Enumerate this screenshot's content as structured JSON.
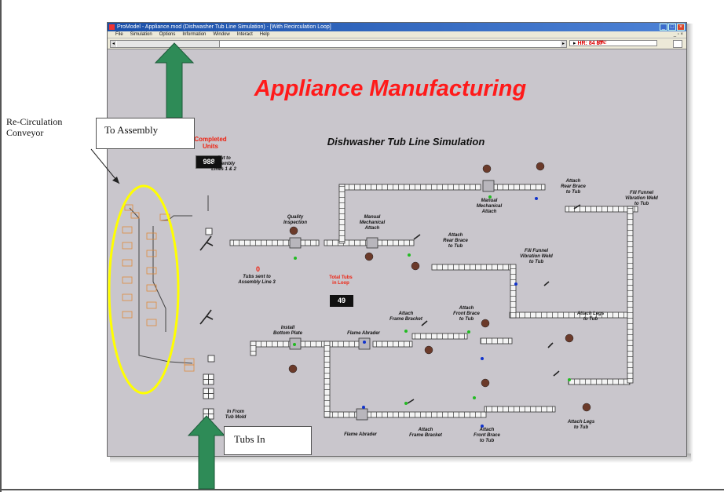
{
  "window": {
    "title": "ProModel - Appliance.mod (Dishwasher Tub Line Simulation) - [With Recirculation Loop]",
    "menu": [
      "File",
      "Simulation",
      "Options",
      "Information",
      "Window",
      "Interact",
      "Help"
    ],
    "clock": {
      "hr_label": "HR:",
      "hr": "84",
      "min_label": "MIN:",
      "min": "17"
    }
  },
  "display": {
    "title": "Appliance Manufacturing",
    "subtitle": "Dishwasher Tub Line Simulation",
    "completed_label_1": "Completed",
    "completed_label_2": "Units",
    "completed_value": "988",
    "loop_label_1": "Total Tubs",
    "loop_label_2": "in Loop",
    "loop_value": "49",
    "sent_value": "0"
  },
  "labels": {
    "out_to_assembly": [
      "Out to",
      "Assembly",
      "Lines 1 & 2"
    ],
    "tubs_sent": [
      "Tubs sent to",
      "Assembly Line 3"
    ],
    "in_from_tub_mold": [
      "In From",
      "Tub Mold"
    ],
    "quality_inspection": [
      "Quality",
      "Inspection"
    ],
    "manual_mech_top": [
      "Manual",
      "Mechanical",
      "Attach"
    ],
    "manual_mech_right": [
      "Manual",
      "Mechanical",
      "Attach"
    ],
    "attach_rear_brace_top": [
      "Attach",
      "Rear Brace",
      "to Tub"
    ],
    "fill_funnel_top": [
      "Fill Funnel",
      "Vibration Weld",
      "to Tub"
    ],
    "attach_rear_brace_mid": [
      "Attach",
      "Rear Brace",
      "to Tub"
    ],
    "fill_funnel_mid": [
      "Fill Funnel",
      "Vibration Weld",
      "to Tub"
    ],
    "attach_legs_mid": [
      "Attach Legs",
      "to Tub"
    ],
    "install_bottom_plate": [
      "Install",
      "Bottom Plate"
    ],
    "flame_abrader_mid": [
      "Flame Abrader"
    ],
    "attach_frame_bracket_mid": [
      "Attach",
      "Frame Bracket"
    ],
    "attach_front_brace_mid": [
      "Attach",
      "Front Brace",
      "to Tub"
    ],
    "flame_abrader_bottom": [
      "Flame Abrader"
    ],
    "attach_frame_bracket_bottom": [
      "Attach",
      "Frame Bracket"
    ],
    "attach_front_brace_bottom": [
      "Attach",
      "Front Brace",
      "to Tub"
    ],
    "attach_legs_bottom": [
      "Attach Legs",
      "to Tub"
    ]
  },
  "annotations": {
    "recirc": [
      "Re-Circulation",
      "Conveyor"
    ],
    "to_assembly": "To Assembly",
    "tubs_in": "Tubs In"
  },
  "colors": {
    "title_red": "#ff1a1a",
    "arrow_green": "#2e8b57",
    "highlight_yellow": "#ffff00",
    "canvas": "#c9c6cc"
  }
}
